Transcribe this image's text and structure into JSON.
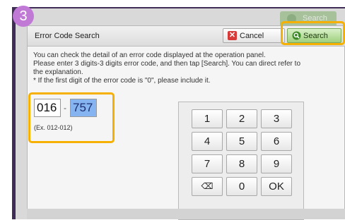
{
  "step_badge": "3",
  "background": {
    "search_label": "Search"
  },
  "dialog": {
    "title": "Error Code Search",
    "cancel_label": "Cancel",
    "search_label": "Search",
    "description_lines": [
      "You can check the detail of an error code displayed at the operation panel.",
      "Please enter 3 digits-3 digits error code, and then tap [Search]. You can direct refer to",
      "the explanation.",
      "* If the first digit of the error code is \"0\", please include it."
    ],
    "code_first": "016",
    "separator": "-",
    "code_second": "757",
    "example": "(Ex. 012-012)"
  },
  "keypad": {
    "keys": [
      "1",
      "2",
      "3",
      "4",
      "5",
      "6",
      "7",
      "8",
      "9",
      "⌫",
      "0",
      "OK"
    ]
  },
  "colors": {
    "highlight": "#f5b000",
    "badge": "#c07ad6",
    "search_button": "#9fd07f",
    "selected_field": "#86b4f0"
  }
}
